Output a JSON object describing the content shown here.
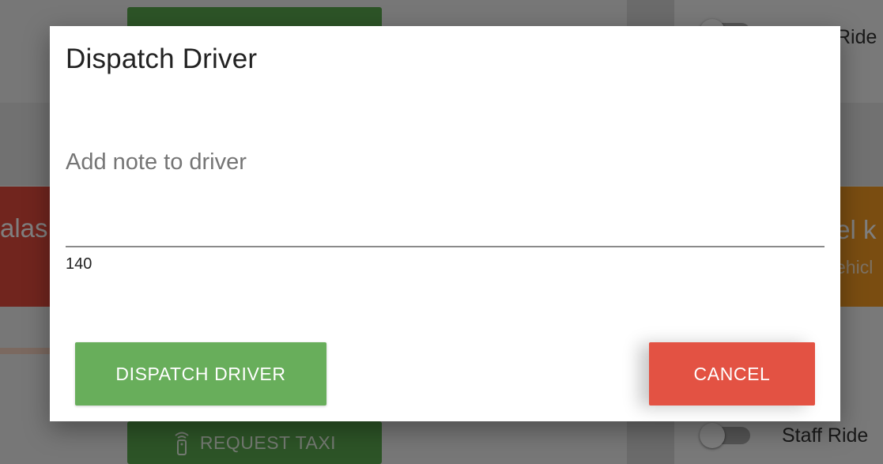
{
  "background": {
    "left_card_text": "alas",
    "right_card_title": "tel k",
    "right_card_subtitle": "ehicl",
    "request_button_label": "REQUEST TAXI",
    "top_toggle_label": "Ride",
    "bottom_toggle_label": "Staff Ride"
  },
  "dialog": {
    "title": "Dispatch Driver",
    "note": {
      "placeholder": "Add note to driver",
      "value": "",
      "char_counter": "140"
    },
    "buttons": {
      "dispatch_label": "DISPATCH DRIVER",
      "cancel_label": "CANCEL"
    }
  },
  "colors": {
    "dispatch_green": "#68ae5b",
    "cancel_red": "#e35243",
    "alert_red_card": "#e24a3d",
    "orange_card": "#f59a22"
  }
}
